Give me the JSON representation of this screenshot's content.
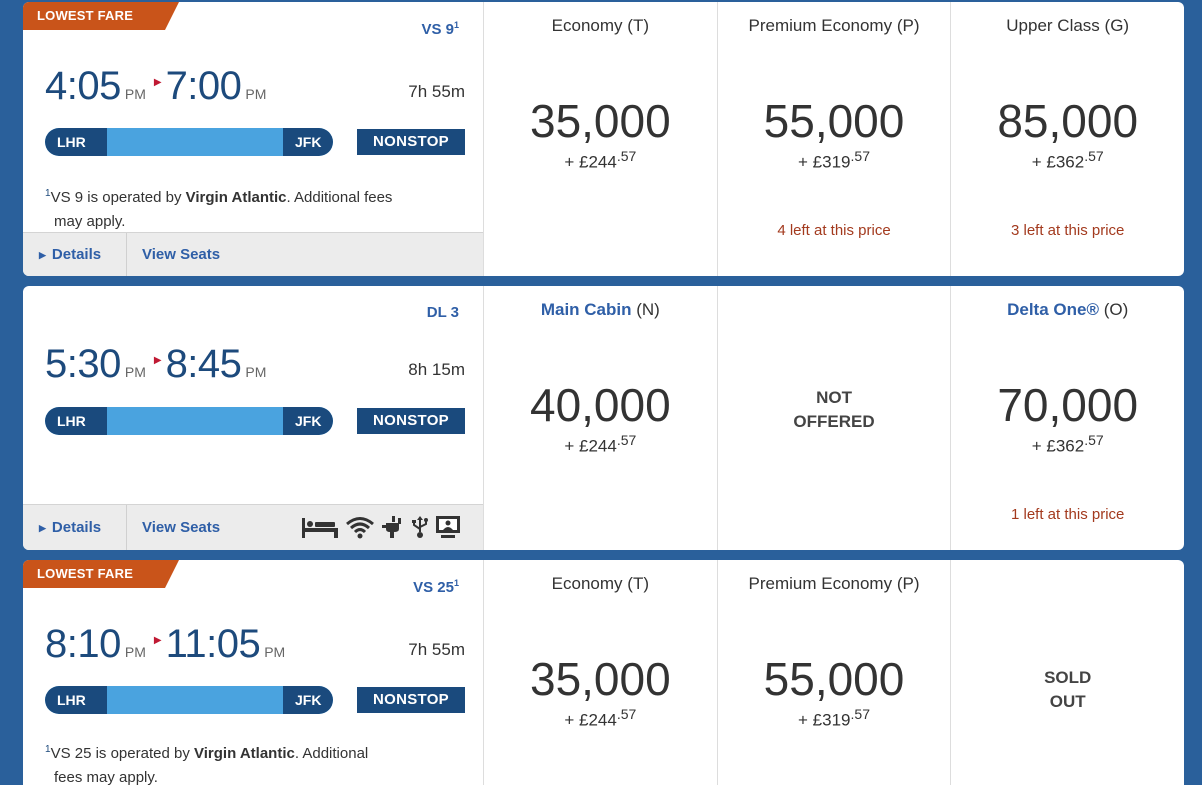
{
  "flights": [
    {
      "badge": "LOWEST FARE",
      "flight_number": "VS 9",
      "footnote_mark": "1",
      "depart_time": "4:05",
      "depart_ampm": "PM",
      "arrive_time": "7:00",
      "arrive_ampm": "PM",
      "duration": "7h 55m",
      "origin": "LHR",
      "destination": "JFK",
      "stops": "NONSTOP",
      "footnote_line1_pre": "VS 9 is operated by ",
      "footnote_operator": "Virgin Atlantic",
      "footnote_line1_post": ". Additional fees",
      "footnote_line2": "may apply.",
      "details_label": "Details",
      "view_seats_label": "View Seats",
      "fares": [
        {
          "cabin": "Economy",
          "code": "(T)",
          "miles": "35,000",
          "cash_prefix": "+ £",
          "cash_main": "244",
          "cash_cents": ".57",
          "seats_left": ""
        },
        {
          "cabin": "Premium Economy",
          "code": "(P)",
          "miles": "55,000",
          "cash_prefix": "+ £",
          "cash_main": "319",
          "cash_cents": ".57",
          "seats_left": "4 left at this price"
        },
        {
          "cabin": "Upper Class",
          "code": "(G)",
          "miles": "85,000",
          "cash_prefix": "+ £",
          "cash_main": "362",
          "cash_cents": ".57",
          "seats_left": "3 left at this price"
        }
      ]
    },
    {
      "flight_number": "DL 3",
      "depart_time": "5:30",
      "depart_ampm": "PM",
      "arrive_time": "8:45",
      "arrive_ampm": "PM",
      "duration": "8h 15m",
      "origin": "LHR",
      "destination": "JFK",
      "stops": "NONSTOP",
      "details_label": "Details",
      "view_seats_label": "View Seats",
      "amenities": [
        "flat-bed-icon",
        "wifi-icon",
        "power-outlet-icon",
        "usb-icon",
        "personal-screen-icon"
      ],
      "fares": [
        {
          "cabin": "Main Cabin",
          "code": "(N)",
          "miles": "40,000",
          "cash_prefix": "+ £",
          "cash_main": "244",
          "cash_cents": ".57",
          "seats_left": ""
        },
        {
          "status_line1": "NOT",
          "status_line2": "OFFERED"
        },
        {
          "cabin": "Delta One®",
          "code": "(O)",
          "miles": "70,000",
          "cash_prefix": "+ £",
          "cash_main": "362",
          "cash_cents": ".57",
          "seats_left": "1 left at this price"
        }
      ]
    },
    {
      "badge": "LOWEST FARE",
      "flight_number": "VS 25",
      "footnote_mark": "1",
      "depart_time": "8:10",
      "depart_ampm": "PM",
      "arrive_time": "11:05",
      "arrive_ampm": "PM",
      "duration": "7h 55m",
      "origin": "LHR",
      "destination": "JFK",
      "stops": "NONSTOP",
      "footnote_line1_pre": "VS 25 is operated by ",
      "footnote_operator": "Virgin Atlantic",
      "footnote_line1_post": ". Additional",
      "footnote_line2": "fees may apply.",
      "fares": [
        {
          "cabin": "Economy",
          "code": "(T)",
          "miles": "35,000",
          "cash_prefix": "+ £",
          "cash_main": "244",
          "cash_cents": ".57"
        },
        {
          "cabin": "Premium Economy",
          "code": "(P)",
          "miles": "55,000",
          "cash_prefix": "+ £",
          "cash_main": "319",
          "cash_cents": ".57"
        },
        {
          "status_line1": "SOLD",
          "status_line2": "OUT"
        }
      ]
    }
  ],
  "colors": {
    "background": "#2a609b",
    "badge": "#c9541a",
    "navy": "#1a4a7d",
    "route_bar": "#4aa3df",
    "link": "#2f5fa7",
    "scarcity": "#a33a1e",
    "arrow": "#c01933"
  }
}
